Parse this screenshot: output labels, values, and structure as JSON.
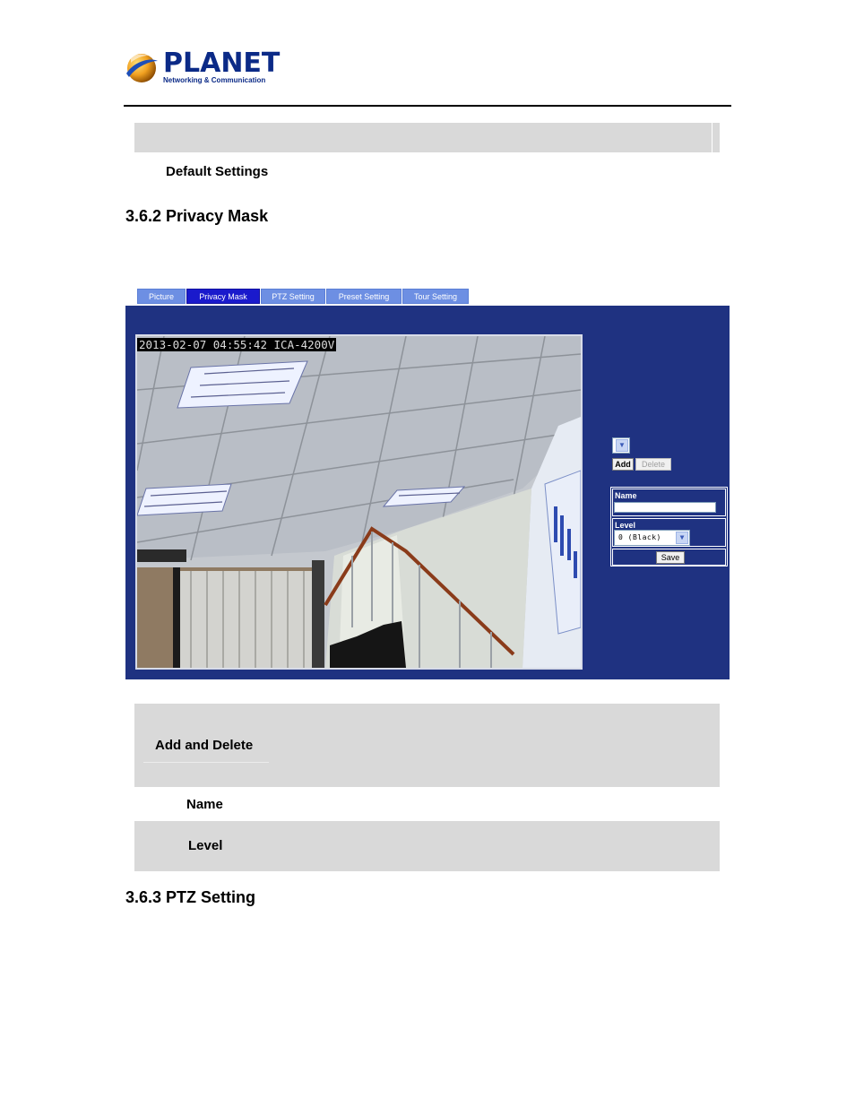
{
  "logo": {
    "brand": "PLANET",
    "tagline": "Networking & Communication"
  },
  "sections": {
    "default_settings": "Default Settings",
    "privacy_mask_heading": "3.6.2 Privacy Mask",
    "ptz_heading": "3.6.3 PTZ Setting"
  },
  "tabs": [
    {
      "label": "Picture",
      "active": false
    },
    {
      "label": "Privacy Mask",
      "active": true
    },
    {
      "label": "PTZ Setting",
      "active": false
    },
    {
      "label": "Preset Setting",
      "active": false
    },
    {
      "label": "Tour Setting",
      "active": false
    }
  ],
  "camera": {
    "osd": "2013-02-07 04:55:42 ICA-4200V"
  },
  "mask_controls": {
    "select_value": "",
    "add_label": "Add",
    "delete_label": "Delete"
  },
  "form": {
    "name_label": "Name",
    "name_value": "",
    "level_label": "Level",
    "level_value": "0 (Black)",
    "save_label": "Save"
  },
  "descriptions": {
    "add_delete": "Add and Delete",
    "name": "Name",
    "level": "Level"
  },
  "colors": {
    "panel_bg": "#1f3281",
    "tab_bg": "#6d8fe3",
    "tab_active_bg": "#1a1acc",
    "gray_row": "#d9d9d9",
    "brand": "#0b2a87"
  }
}
